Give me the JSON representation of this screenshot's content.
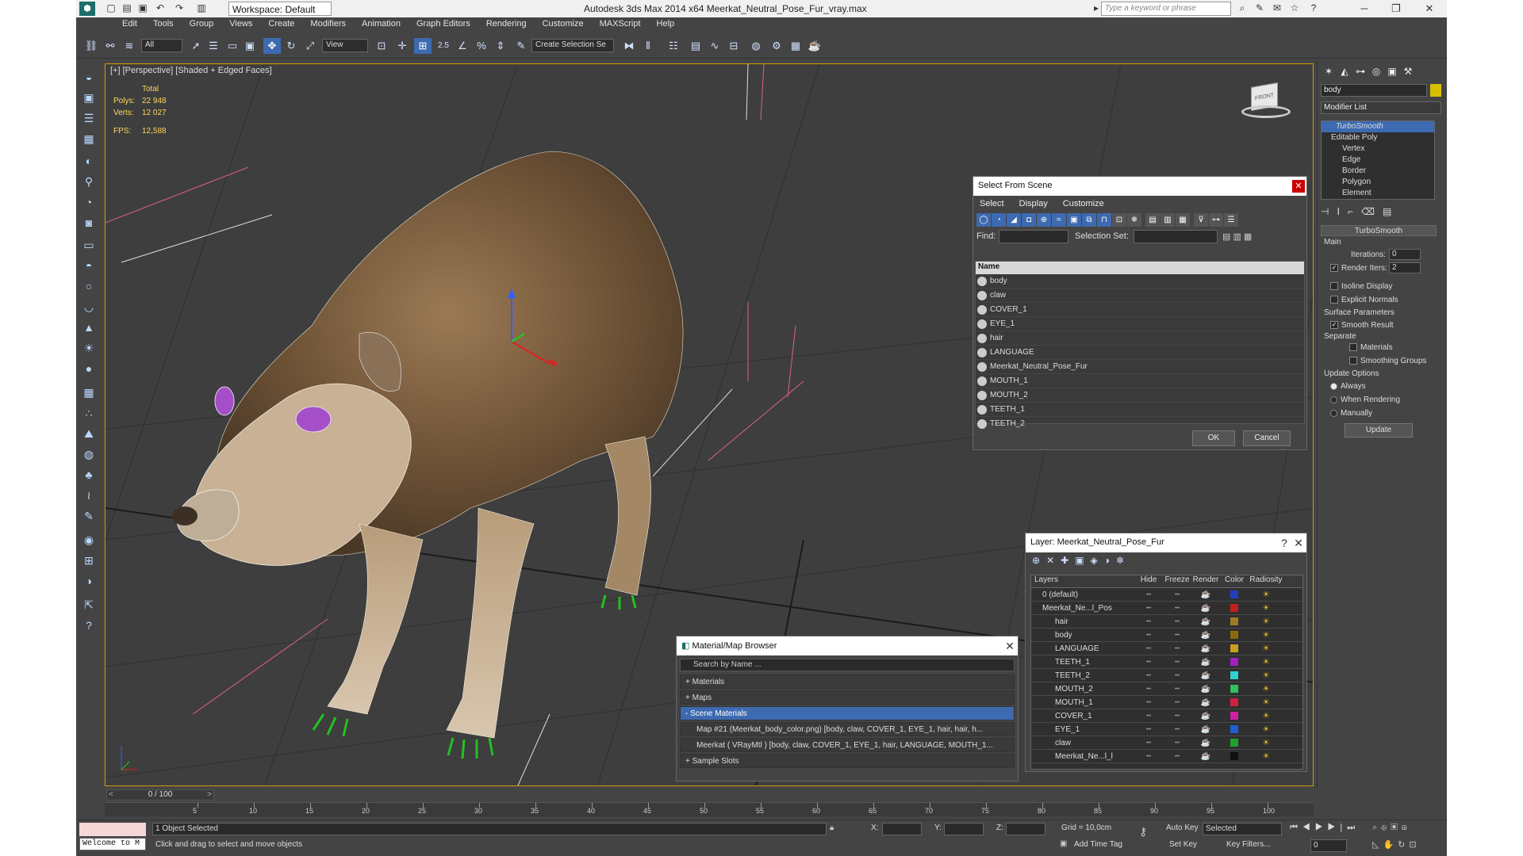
{
  "window": {
    "title": "Autodesk 3ds Max  2014 x64     Meerkat_Neutral_Pose_Fur_vray.max",
    "workspace": "Workspace: Default",
    "search_placeholder": "Type a keyword or phrase"
  },
  "menu": [
    "Edit",
    "Tools",
    "Group",
    "Views",
    "Create",
    "Modifiers",
    "Animation",
    "Graph Editors",
    "Rendering",
    "Customize",
    "MAXScript",
    "Help"
  ],
  "toolbar": {
    "selection_filter": "All",
    "coord_system": "View",
    "snap_label": "2.5",
    "named_selection": "Create Selection Se"
  },
  "viewport": {
    "label": "[+] [Perspective] [Shaded + Edged Faces]",
    "stats": {
      "total_label": "Total",
      "polys_label": "Polys:",
      "polys": "22 948",
      "verts_label": "Verts:",
      "verts": "12 027",
      "fps_label": "FPS:",
      "fps": "12,588"
    }
  },
  "select_from_scene": {
    "title": "Select From Scene",
    "menu": [
      "Select",
      "Display",
      "Customize"
    ],
    "find_label": "Find:",
    "selection_set_label": "Selection Set:",
    "column_name": "Name",
    "items": [
      "body",
      "claw",
      "COVER_1",
      "EYE_1",
      "hair",
      "LANGUAGE",
      "Meerkat_Neutral_Pose_Fur",
      "MOUTH_1",
      "MOUTH_2",
      "TEETH_1",
      "TEETH_2"
    ],
    "ok": "OK",
    "cancel": "Cancel"
  },
  "layer_dialog": {
    "title": "Layer: Meerkat_Neutral_Pose_Fur",
    "columns": [
      "Layers",
      "Hide",
      "Freeze",
      "Render",
      "Color",
      "Radiosity"
    ],
    "rows": [
      {
        "name": "0 (default)",
        "color": "#1f3fbf"
      },
      {
        "name": "Meerkat_Ne...l_Pos",
        "color": "#c02020"
      },
      {
        "name": "hair",
        "color": "#a07a20"
      },
      {
        "name": "body",
        "color": "#8a6a10"
      },
      {
        "name": "LANGUAGE",
        "color": "#c8a020"
      },
      {
        "name": "TEETH_1",
        "color": "#a020c0"
      },
      {
        "name": "TEETH_2",
        "color": "#30d0d0"
      },
      {
        "name": "MOUTH_2",
        "color": "#30c060"
      },
      {
        "name": "MOUTH_1",
        "color": "#d02040"
      },
      {
        "name": "COVER_1",
        "color": "#d020a0"
      },
      {
        "name": "EYE_1",
        "color": "#2060d0"
      },
      {
        "name": "claw",
        "color": "#20a030"
      },
      {
        "name": "Meerkat_Ne...l_l",
        "color": "#101010"
      }
    ]
  },
  "material_browser": {
    "title": "Material/Map Browser",
    "search_placeholder": "Search by Name ...",
    "sections": [
      "+ Materials",
      "+ Maps",
      "- Scene Materials"
    ],
    "scene_items": [
      "Map #21 (Meerkat_body_color.png)  [body, claw, COVER_1, EYE_1, hair, hair, h...",
      "Meerkat  ( VRayMtl )  [body, claw, COVER_1, EYE_1, hair, LANGUAGE, MOUTH_1..."
    ],
    "sample_slots": "+ Sample Slots"
  },
  "command_panel": {
    "object_name": "body",
    "modifier_list": "Modifier List",
    "stack": [
      "TurboSmooth",
      "Editable Poly",
      "Vertex",
      "Edge",
      "Border",
      "Polygon",
      "Element"
    ],
    "turbosmooth": {
      "title": "TurboSmooth",
      "main": "Main",
      "iterations_label": "Iterations:",
      "iterations": "0",
      "render_iters_label": "Render Iters:",
      "render_iters": "2",
      "isoline": "Isoline Display",
      "explicit_normals": "Explicit Normals",
      "surface_params": "Surface Parameters",
      "smooth_result": "Smooth Result",
      "separate": "Separate",
      "materials": "Materials",
      "smoothing_groups": "Smoothing Groups",
      "update_options": "Update Options",
      "always": "Always",
      "when_rendering": "When Rendering",
      "manually": "Manually",
      "update": "Update"
    }
  },
  "timeline": {
    "frame": "0 / 100",
    "ticks": [
      "5",
      "10",
      "15",
      "20",
      "25",
      "30",
      "35",
      "40",
      "45",
      "50",
      "55",
      "60",
      "65",
      "70",
      "75",
      "80",
      "85",
      "90",
      "95",
      "100"
    ]
  },
  "status": {
    "selected": "1 Object Selected",
    "prompt": "Click and drag to select and move objects",
    "welcome": "Welcome to M",
    "x_label": "X:",
    "y_label": "Y:",
    "z_label": "Z:",
    "grid": "Grid = 10,0cm",
    "auto_key": "Auto Key",
    "set_key": "Set Key",
    "key_mode": "Selected",
    "key_filters": "Key Filters...",
    "add_time_tag": "Add Time Tag",
    "frame_field": "0"
  }
}
